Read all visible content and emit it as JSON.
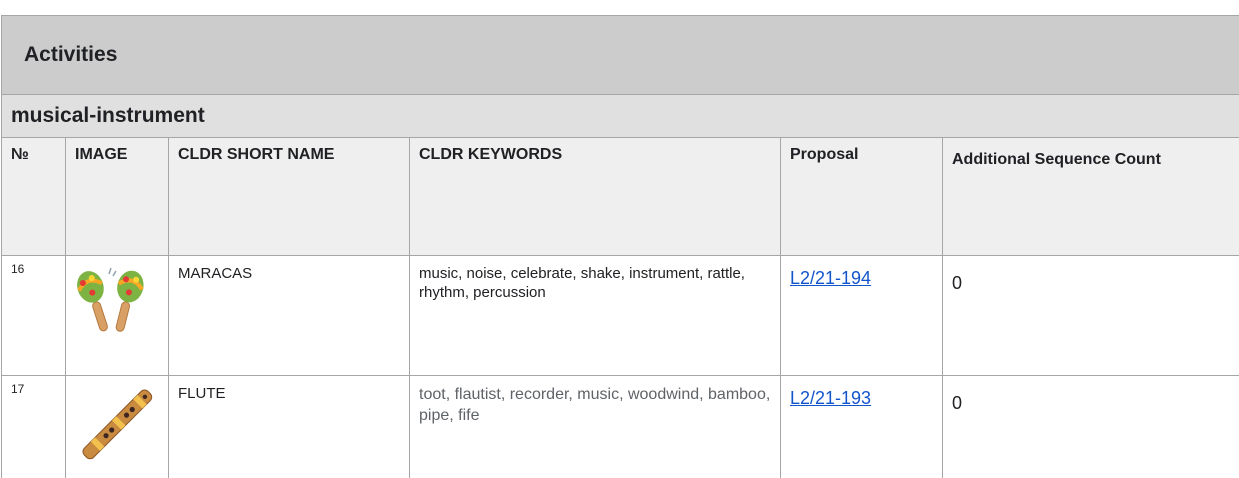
{
  "section_title": "Activities",
  "subsection_title": "musical-instrument",
  "columns": [
    "№",
    "IMAGE",
    "CLDR SHORT NAME",
    "CLDR KEYWORDS",
    "Proposal",
    "Additional Sequence Count"
  ],
  "rows": [
    {
      "num": "16",
      "image_icon": "maracas-icon",
      "short_name": "MARACAS",
      "keywords": "music, noise, celebrate, shake, instrument, rattle, rhythm, percussion",
      "proposal": "L2/21-194",
      "seq_count": "0"
    },
    {
      "num": "17",
      "image_icon": "flute-icon",
      "short_name": "FLUTE",
      "keywords": "toot, flautist, recorder, music, woodwind, bamboo, pipe, fife",
      "proposal": "L2/21-193",
      "seq_count": "0"
    }
  ],
  "colors": {
    "section_bg": "#cccccc",
    "subsection_bg": "#e0e0e0",
    "header_bg": "#efefef",
    "link": "#1155cc",
    "border": "#a6a6a6"
  }
}
